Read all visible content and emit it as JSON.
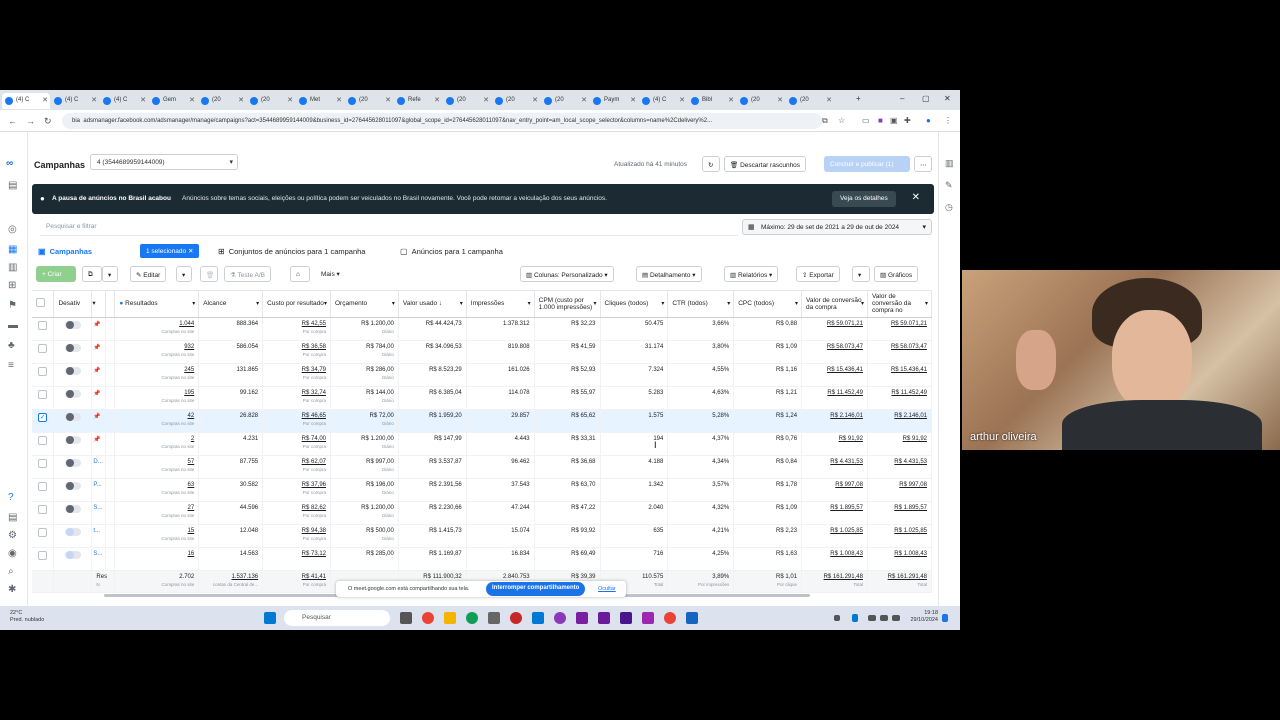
{
  "browser": {
    "tabs": [
      {
        "label": "(4) C",
        "active": true
      },
      {
        "label": "(4) C"
      },
      {
        "label": "(4) C"
      },
      {
        "label": "Gem"
      },
      {
        "label": "(20"
      },
      {
        "label": "(20"
      },
      {
        "label": "Met"
      },
      {
        "label": "(20"
      },
      {
        "label": "Refe"
      },
      {
        "label": "(20"
      },
      {
        "label": "(20"
      },
      {
        "label": "(20"
      },
      {
        "label": "Paym"
      },
      {
        "label": "(4) C"
      },
      {
        "label": "Bibl"
      },
      {
        "label": "(20"
      },
      {
        "label": "(20"
      }
    ],
    "url_prefix": "bia",
    "url": "adsmanager.facebook.com/adsmanager/manage/campaigns?act=3544689959144009&business_id=276445628011097&global_scope_id=276445628011097&nav_entry_point=am_local_scope_selector&columns=name%2Cdelivery%2..."
  },
  "header": {
    "title": "Campanhas",
    "account": "4 (3544689959144009)",
    "updated": "Atualizado há 41 minutos",
    "discard": "Descartar rascunhos",
    "publish": "Concluir e publicar (1)"
  },
  "banner": {
    "bold": "A pausa de anúncios no Brasil acabou",
    "text": "Anúncios sobre temas sociais, eleições ou política podem ser veiculados no Brasil novamente. Você pode retomar a veiculação dos seus anúncios.",
    "details": "Veja os detalhes"
  },
  "search": {
    "placeholder": "Pesquisar e filtrar"
  },
  "date_range": "Máximo: 29 de set de 2021 a 29 de out de 2024",
  "levels": {
    "campaigns": "Campanhas",
    "selected_chip": "1 selecionado",
    "adsets": "Conjuntos de anúncios para 1 campanha",
    "ads": "Anúncios para 1 campanha"
  },
  "toolbar": {
    "create": "+ Criar",
    "edit": "Editar",
    "ab_test": "Teste A/B",
    "more": "Mais",
    "columns": "Colunas: Personalizado",
    "breakdown": "Detalhamento",
    "reports": "Relatórios",
    "export": "Exportar",
    "charts": "Gráficos"
  },
  "table": {
    "headers": {
      "off_on": "Desativ",
      "results": "Resultados",
      "reach": "Alcance",
      "cost_per_result": "Custo por resultado",
      "budget": "Orçamento",
      "amount_spent": "Valor usado ↓",
      "impressions": "Impressões",
      "cpm": "CPM (custo por 1.000 impressões)",
      "clicks": "Cliques (todos)",
      "ctr": "CTR (todos)",
      "cpc": "CPC (todos)",
      "conv_value": "Valor de conversão da compra",
      "conv_value2": "Valor de conversão da compra no"
    },
    "rows": [
      {
        "name": "",
        "results": "1.044",
        "results_sub": "Compras no site",
        "reach": "888.364",
        "cpr": "R$ 42,55",
        "cpr_sub": "Por compra",
        "budget": "R$ 1.200,00",
        "budget_sub": "Diário",
        "spent": "R$ 44.424,73",
        "impr": "1.378.312",
        "cpm": "R$ 32,23",
        "clicks": "50.475",
        "ctr": "3,66%",
        "cpc": "R$ 0,88",
        "conv": "R$ 59.071,21",
        "conv2": "R$ 59.071,21",
        "checked": false
      },
      {
        "name": "",
        "results": "932",
        "results_sub": "Compras no site",
        "reach": "586.054",
        "cpr": "R$ 36,58",
        "cpr_sub": "Por compra",
        "budget": "R$ 784,00",
        "budget_sub": "Diário",
        "spent": "R$ 34.096,53",
        "impr": "819.808",
        "cpm": "R$ 41,59",
        "clicks": "31.174",
        "ctr": "3,80%",
        "cpc": "R$ 1,09",
        "conv": "R$ 58.073,47",
        "conv2": "R$ 58.073,47",
        "checked": false
      },
      {
        "name": "",
        "results": "245",
        "results_sub": "Compras no site",
        "reach": "131.865",
        "cpr": "R$ 34,79",
        "cpr_sub": "Por compra",
        "budget": "R$ 286,00",
        "budget_sub": "Diário",
        "spent": "R$ 8.523,29",
        "impr": "161.026",
        "cpm": "R$ 52,93",
        "clicks": "7.324",
        "ctr": "4,55%",
        "cpc": "R$ 1,16",
        "conv": "R$ 15.436,41",
        "conv2": "R$ 15.436,41",
        "checked": false
      },
      {
        "name": "",
        "results": "195",
        "results_sub": "Compras no site",
        "reach": "99.162",
        "cpr": "R$ 32,74",
        "cpr_sub": "Por compra",
        "budget": "R$ 144,00",
        "budget_sub": "Diário",
        "spent": "R$ 6.385,04",
        "impr": "114.078",
        "cpm": "R$ 55,97",
        "clicks": "5.283",
        "ctr": "4,63%",
        "cpc": "R$ 1,21",
        "conv": "R$ 11.452,49",
        "conv2": "R$ 11.452,49",
        "checked": false
      },
      {
        "name": "",
        "results": "42",
        "results_sub": "Compras no site",
        "reach": "26.828",
        "cpr": "R$ 46,65",
        "cpr_sub": "Por compra",
        "budget": "R$ 72,00",
        "budget_sub": "Diário",
        "spent": "R$ 1.959,20",
        "impr": "29.857",
        "cpm": "R$ 65,62",
        "clicks": "1.575",
        "ctr": "5,28%",
        "cpc": "R$ 1,24",
        "conv": "R$ 2.146,01",
        "conv2": "R$ 2.146,01",
        "checked": true
      },
      {
        "name": "",
        "results": "2",
        "results_sub": "Compras no site",
        "reach": "4.231",
        "cpr": "R$ 74,00",
        "cpr_sub": "Por compra",
        "budget": "R$ 1.200,00",
        "budget_sub": "Diário",
        "spent": "R$ 147,99",
        "impr": "4.443",
        "cpm": "R$ 33,31",
        "clicks": "194",
        "ctr": "4,37%",
        "cpc": "R$ 0,76",
        "conv": "R$ 91,92",
        "conv2": "R$ 91,92",
        "checked": false
      },
      {
        "name": "D...",
        "results": "57",
        "results_sub": "Compras no site",
        "reach": "87.755",
        "cpr": "R$ 62,07",
        "cpr_sub": "Por compra",
        "budget": "R$ 997,00",
        "budget_sub": "Diário",
        "spent": "R$ 3.537,87",
        "impr": "96.462",
        "cpm": "R$ 36,68",
        "clicks": "4.188",
        "ctr": "4,34%",
        "cpc": "R$ 0,84",
        "conv": "R$ 4.431,53",
        "conv2": "R$ 4.431,53",
        "checked": false
      },
      {
        "name": "P...",
        "results": "63",
        "results_sub": "Compras no site",
        "reach": "30.582",
        "cpr": "R$ 37,96",
        "cpr_sub": "Por compra",
        "budget": "R$ 196,00",
        "budget_sub": "Diário",
        "spent": "R$ 2.391,56",
        "impr": "37.543",
        "cpm": "R$ 63,70",
        "clicks": "1.342",
        "ctr": "3,57%",
        "cpc": "R$ 1,78",
        "conv": "R$ 997,08",
        "conv2": "R$ 997,08",
        "checked": false
      },
      {
        "name": "S...",
        "results": "27",
        "results_sub": "Compras no site",
        "reach": "44.596",
        "cpr": "R$ 82,62",
        "cpr_sub": "Por compra",
        "budget": "R$ 1.200,00",
        "budget_sub": "Diário",
        "spent": "R$ 2.230,66",
        "impr": "47.244",
        "cpm": "R$ 47,22",
        "clicks": "2.040",
        "ctr": "4,32%",
        "cpc": "R$ 1,09",
        "conv": "R$ 1.895,57",
        "conv2": "R$ 1.895,57",
        "checked": false
      },
      {
        "name": "t...",
        "results": "15",
        "results_sub": "Compras no site",
        "reach": "12.048",
        "cpr": "R$ 94,38",
        "cpr_sub": "Por compra",
        "budget": "R$ 500,00",
        "budget_sub": "Diário",
        "spent": "R$ 1.415,73",
        "impr": "15.074",
        "cpm": "R$ 93,92",
        "clicks": "635",
        "ctr": "4,21%",
        "cpc": "R$ 2,23",
        "conv": "R$ 1.025,85",
        "conv2": "R$ 1.025,85",
        "checked": false
      },
      {
        "name": "S...",
        "results": "16",
        "results_sub": "",
        "reach": "14.563",
        "cpr": "R$ 73,12",
        "cpr_sub": "",
        "budget": "R$ 285,00",
        "budget_sub": "",
        "spent": "R$ 1.169,87",
        "impr": "16.834",
        "cpm": "R$ 69,49",
        "clicks": "716",
        "ctr": "4,25%",
        "cpc": "R$ 1,63",
        "conv": "R$ 1.008,43",
        "conv2": "R$ 1.008,43",
        "checked": false
      }
    ],
    "totals": {
      "label": "Res",
      "label2": "N",
      "results": "2.702",
      "results_sub": "Compras no site",
      "reach": "1.537.136",
      "reach_sub": "contas da Central de...",
      "cpr": "R$ 41,41",
      "cpr_sub": "Por compra",
      "spent": "R$ 111.900,32",
      "impr": "2.840.753",
      "cpm": "R$ 39,39",
      "clicks": "110.575",
      "clicks_sub": "Total",
      "ctr": "3,89%",
      "ctr_sub": "Por impressões",
      "cpc": "R$ 1,01",
      "cpc_sub": "Por clique",
      "conv": "R$ 161.291,48",
      "conv_sub": "Total",
      "conv2": "R$ 161.291,48",
      "conv2_sub": "Total"
    }
  },
  "meet": {
    "text": "O meet.google.com está compartilhando sua tela.",
    "stop": "Interromper compartilhamento",
    "hide": "Ocultar"
  },
  "taskbar": {
    "temp": "22°C",
    "weather": "Pred. nublado",
    "search": "Pesquisar",
    "time": "19:18",
    "date": "29/10/2024"
  },
  "webcam": {
    "name": "arthur oliveira"
  }
}
